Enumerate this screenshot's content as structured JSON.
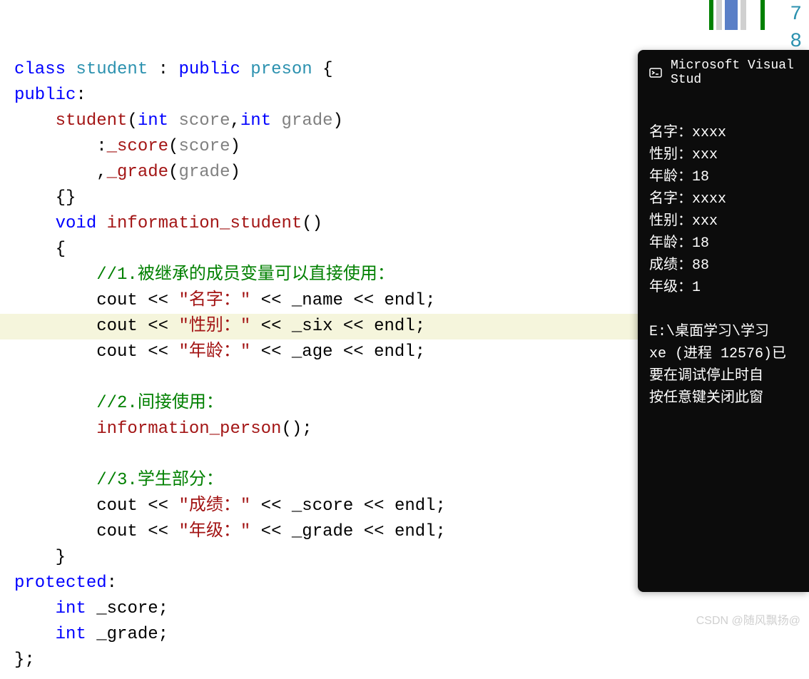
{
  "code": {
    "keywords": {
      "class": "class",
      "public": "public",
      "void": "void",
      "int": "int",
      "protected": "protected"
    },
    "types": {
      "student": "student",
      "preson": "preson"
    },
    "methods": {
      "student_ctor": "student",
      "score_init": "_score",
      "grade_init": "_grade",
      "info_student": "information_student",
      "info_person": "information_person"
    },
    "params": {
      "score": "score",
      "grade": "grade"
    },
    "identifiers": {
      "cout": "cout",
      "endl": "endl",
      "name": "_name",
      "six": "_six",
      "age": "_age",
      "score_var": "_score",
      "grade_var": "_grade"
    },
    "operators": {
      "stream": "<<"
    },
    "strings": {
      "name_label": "\"名字：\"",
      "sex_label": "\"性别：\"",
      "age_label": "\"年龄：\"",
      "score_label": "\"成绩：\"",
      "grade_label": "\"年级：\""
    },
    "comments": {
      "c1": "//1.被继承的成员变量可以直接使用：",
      "c2": "//2.间接使用：",
      "c3": "//3.学生部分："
    }
  },
  "terminal": {
    "title": "Microsoft Visual Stud",
    "output": {
      "l1": "名字：xxxx",
      "l2": "性别：xxx",
      "l3": "年龄：18",
      "l4": "名字：xxxx",
      "l5": "性别：xxx",
      "l6": "年龄：18",
      "l7": "成绩：88",
      "l8": "年级：1",
      "l9": "",
      "l10": "E:\\桌面学习\\学习",
      "l11": "xe (进程 12576)已",
      "l12": "要在调试停止时自",
      "l13": "按任意键关闭此窗"
    }
  },
  "line_numbers": {
    "n7": "7",
    "n8": "8"
  },
  "watermark": "CSDN @随风飘扬@"
}
